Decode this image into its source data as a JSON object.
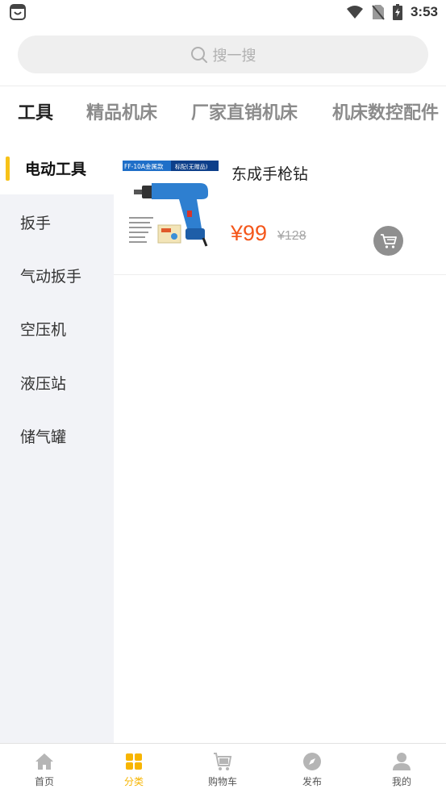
{
  "status_bar": {
    "time": "3:53"
  },
  "search": {
    "placeholder": "搜一搜"
  },
  "top_tabs": [
    {
      "label": "工具",
      "active": true
    },
    {
      "label": "精品机床",
      "active": false
    },
    {
      "label": "厂家直销机床",
      "active": false
    },
    {
      "label": "机床数控配件",
      "active": false
    }
  ],
  "sidebar": {
    "items": [
      {
        "label": "电动工具",
        "active": true
      },
      {
        "label": "扳手"
      },
      {
        "label": "气动扳手"
      },
      {
        "label": "空压机"
      },
      {
        "label": "液压站"
      },
      {
        "label": "储气罐"
      }
    ]
  },
  "products": [
    {
      "name": "东成手枪钻",
      "price": "¥99",
      "original_price": "¥128",
      "image_banner_left": "FF-10A金属款",
      "image_banner_right": "标配(无赠品)"
    }
  ],
  "bottom_nav": [
    {
      "label": "首页",
      "icon": "home-icon"
    },
    {
      "label": "分类",
      "icon": "category-icon",
      "active": true
    },
    {
      "label": "购物车",
      "icon": "cart-icon"
    },
    {
      "label": "发布",
      "icon": "compass-icon"
    },
    {
      "label": "我的",
      "icon": "user-icon"
    }
  ],
  "colors": {
    "accent": "#f7c218",
    "price": "#f4571b",
    "sidebar_bg": "#f2f3f7",
    "inactive_icon": "#b5b5b5"
  }
}
